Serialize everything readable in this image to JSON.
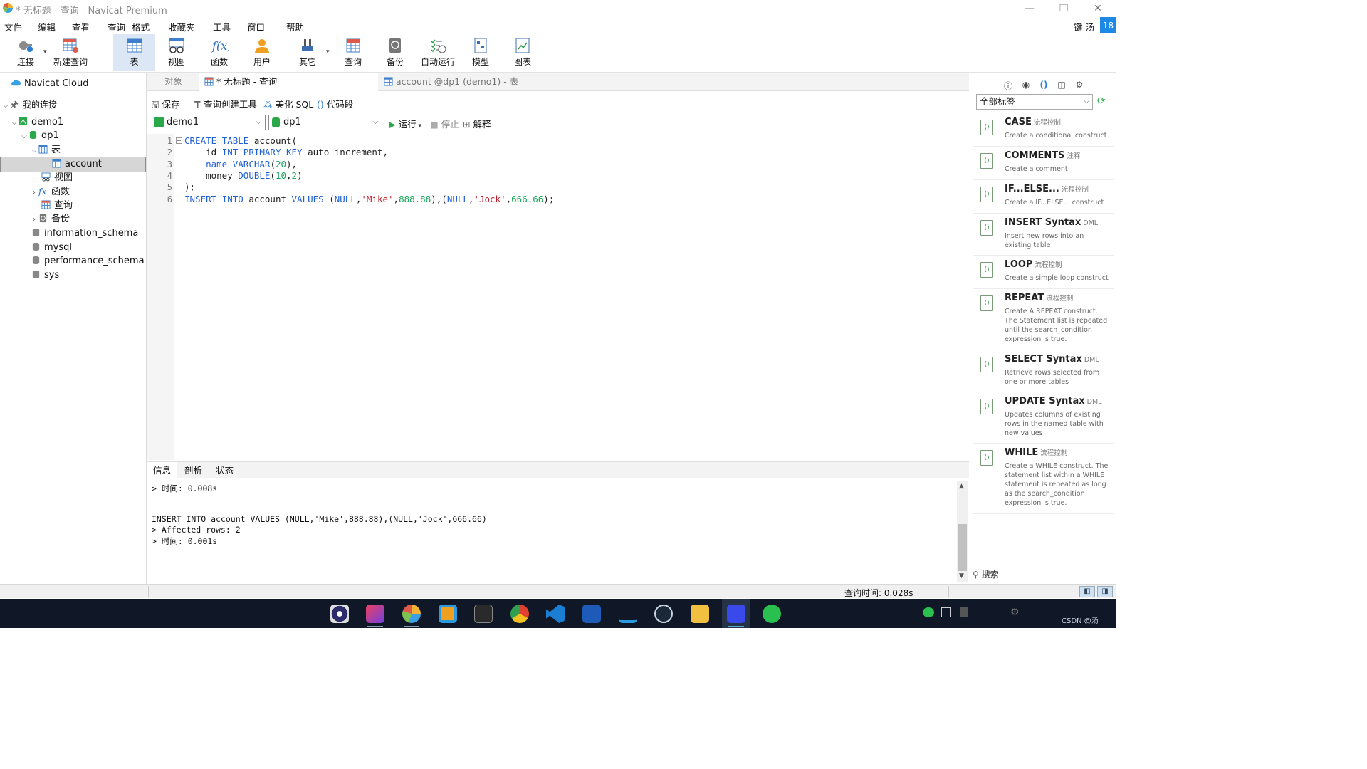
{
  "window": {
    "title": "* 无标题 - 查询 - Navicat Premium",
    "controls": {
      "minimize": "—",
      "restore": "❐",
      "close": "✕"
    }
  },
  "menu": {
    "items": [
      "文件",
      "编辑",
      "查看",
      "查询",
      "格式",
      "收藏夹",
      "工具",
      "窗口",
      "帮助"
    ],
    "user": "键 汤",
    "badge": "18"
  },
  "toolbar": {
    "items": [
      {
        "label": "连接",
        "icon": "plug-icon"
      },
      {
        "label": "新建查询",
        "icon": "new-query-icon"
      },
      {
        "label": "表",
        "icon": "table-icon"
      },
      {
        "label": "视图",
        "icon": "view-icon"
      },
      {
        "label": "函数",
        "icon": "function-icon"
      },
      {
        "label": "用户",
        "icon": "user-icon"
      },
      {
        "label": "其它",
        "icon": "tools-icon"
      },
      {
        "label": "查询",
        "icon": "query-icon"
      },
      {
        "label": "备份",
        "icon": "backup-icon"
      },
      {
        "label": "自动运行",
        "icon": "schedule-icon"
      },
      {
        "label": "模型",
        "icon": "model-icon"
      },
      {
        "label": "图表",
        "icon": "chart-icon"
      }
    ]
  },
  "sidebar": {
    "cloud": "Navicat Cloud",
    "my_connections": "我的连接",
    "conn": "demo1",
    "db": "dp1",
    "tables": "表",
    "table_account": "account",
    "views": "视图",
    "functions": "函数",
    "queries": "查询",
    "backups": "备份",
    "dbs": [
      "information_schema",
      "mysql",
      "performance_schema",
      "sys"
    ]
  },
  "tabs": {
    "objects": "对象",
    "query": "* 无标题 - 查询",
    "table": "account @dp1 (demo1) - 表"
  },
  "query_toolbar": {
    "save": "保存",
    "builder": "查询创建工具",
    "beautify": "美化 SQL",
    "snippet": "代码段",
    "connection": "demo1",
    "database": "dp1",
    "run": "运行",
    "stop": "停止",
    "explain": "解释"
  },
  "editor": {
    "line_numbers": [
      "1",
      "2",
      "3",
      "4",
      "5",
      "6"
    ]
  },
  "info": {
    "tabs": [
      "信息",
      "剖析",
      "状态"
    ],
    "line1": "> 时间: 0.008s",
    "line2": "INSERT INTO account VALUES (NULL,'Mike',888.88),(NULL,'Jock',666.66)",
    "line3": "> Affected rows: 2",
    "line4": "> 时间: 0.001s"
  },
  "right_panel": {
    "tag_select": "全部标签",
    "snippets": [
      {
        "name": "CASE",
        "tag": "流程控制",
        "desc": "Create a conditional construct"
      },
      {
        "name": "COMMENTS",
        "tag": "注释",
        "desc": "Create a comment"
      },
      {
        "name": "IF...ELSE...",
        "tag": "流程控制",
        "desc": "Create a IF...ELSE... construct"
      },
      {
        "name": "INSERT Syntax",
        "tag": "DML",
        "desc": "Insert new rows into an existing table"
      },
      {
        "name": "LOOP",
        "tag": "流程控制",
        "desc": "Create a simple loop construct"
      },
      {
        "name": "REPEAT",
        "tag": "流程控制",
        "desc": "Create A REPEAT construct. The Statement list is repeated until the search_condition expression is true."
      },
      {
        "name": "SELECT Syntax",
        "tag": "DML",
        "desc": "Retrieve rows selected from one or more tables"
      },
      {
        "name": "UPDATE Syntax",
        "tag": "DML",
        "desc": "Updates columns of existing rows in the named table with new values"
      },
      {
        "name": "WHILE",
        "tag": "流程控制",
        "desc": "Create a WHILE construct. The statement list within a WHILE statement is repeated as long as the search_condition expression is true."
      }
    ],
    "search": "搜索"
  },
  "status": {
    "query_time": "查询时间: 0.028s"
  },
  "taskbar": {
    "tray_text": "CSDN @汤"
  }
}
